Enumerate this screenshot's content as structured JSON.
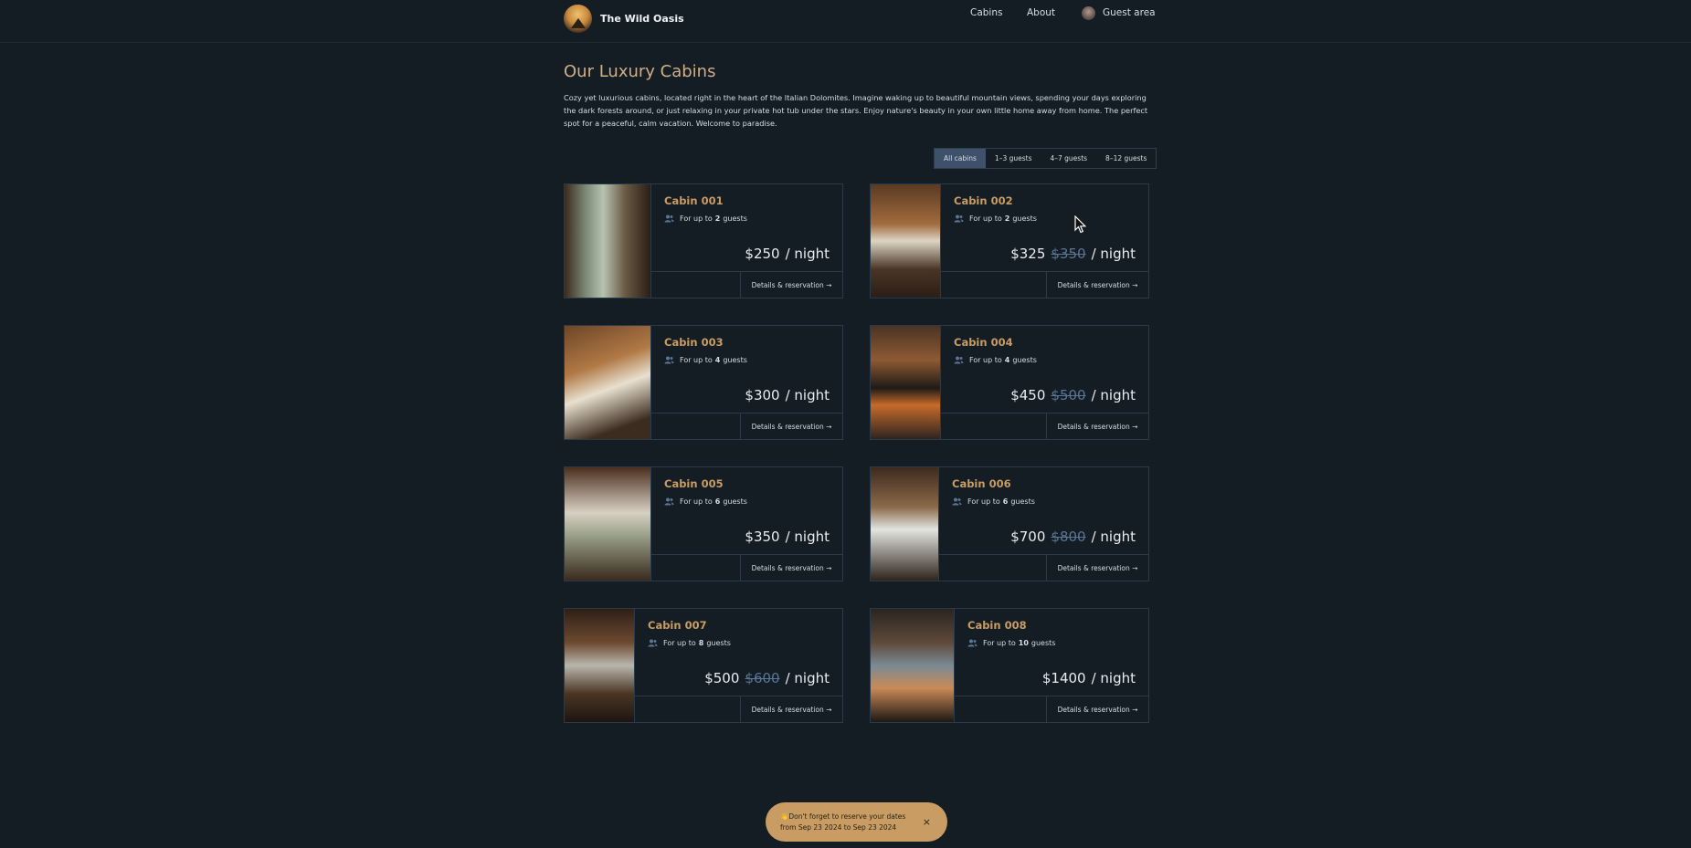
{
  "header": {
    "brand": "The Wild Oasis",
    "nav": {
      "cabins": "Cabins",
      "about": "About",
      "guest": "Guest area"
    }
  },
  "main": {
    "title": "Our Luxury Cabins",
    "intro": "Cozy yet luxurious cabins, located right in the heart of the Italian Dolomites. Imagine waking up to beautiful mountain views, spending your days exploring the dark forests around, or just relaxing in your private hot tub under the stars. Enjoy nature's beauty in your own little home away from home. The perfect spot for a peaceful, calm vacation. Welcome to paradise.",
    "filters": [
      "All cabins",
      "1–3 guests",
      "4–7 guests",
      "8–12 guests"
    ],
    "active_filter": "All cabins"
  },
  "cabins": [
    {
      "name": "Cabin 001",
      "guests_prefix": "For up to",
      "guests": "2",
      "guests_suffix": "guests",
      "price": "$250",
      "old_price": "",
      "per": "/ night",
      "details": "Details & reservation →"
    },
    {
      "name": "Cabin 002",
      "guests_prefix": "For up to",
      "guests": "2",
      "guests_suffix": "guests",
      "price": "$325",
      "old_price": "$350",
      "per": "/ night",
      "details": "Details & reservation →"
    },
    {
      "name": "Cabin 003",
      "guests_prefix": "For up to",
      "guests": "4",
      "guests_suffix": "guests",
      "price": "$300",
      "old_price": "",
      "per": "/ night",
      "details": "Details & reservation →"
    },
    {
      "name": "Cabin 004",
      "guests_prefix": "For up to",
      "guests": "4",
      "guests_suffix": "guests",
      "price": "$450",
      "old_price": "$500",
      "per": "/ night",
      "details": "Details & reservation →"
    },
    {
      "name": "Cabin 005",
      "guests_prefix": "For up to",
      "guests": "6",
      "guests_suffix": "guests",
      "price": "$350",
      "old_price": "",
      "per": "/ night",
      "details": "Details & reservation →"
    },
    {
      "name": "Cabin 006",
      "guests_prefix": "For up to",
      "guests": "6",
      "guests_suffix": "guests",
      "price": "$700",
      "old_price": "$800",
      "per": "/ night",
      "details": "Details & reservation →"
    },
    {
      "name": "Cabin 007",
      "guests_prefix": "For up to",
      "guests": "8",
      "guests_suffix": "guests",
      "price": "$500",
      "old_price": "$600",
      "per": "/ night",
      "details": "Details & reservation →"
    },
    {
      "name": "Cabin 008",
      "guests_prefix": "For up to",
      "guests": "10",
      "guests_suffix": "guests",
      "price": "$1400",
      "old_price": "",
      "per": "/ night",
      "details": "Details & reservation →"
    }
  ],
  "toast": {
    "line1": "👋Don't forget to reserve your dates",
    "line2": "from Sep 23 2024 to Sep 23 2024",
    "close": "×"
  },
  "colors": {
    "background": "#141c24",
    "accent": "#c99c63",
    "active_filter": "#3e506a",
    "strike_price": "#5b7594"
  },
  "icons": {
    "guests": "users-icon",
    "close": "close-icon"
  }
}
